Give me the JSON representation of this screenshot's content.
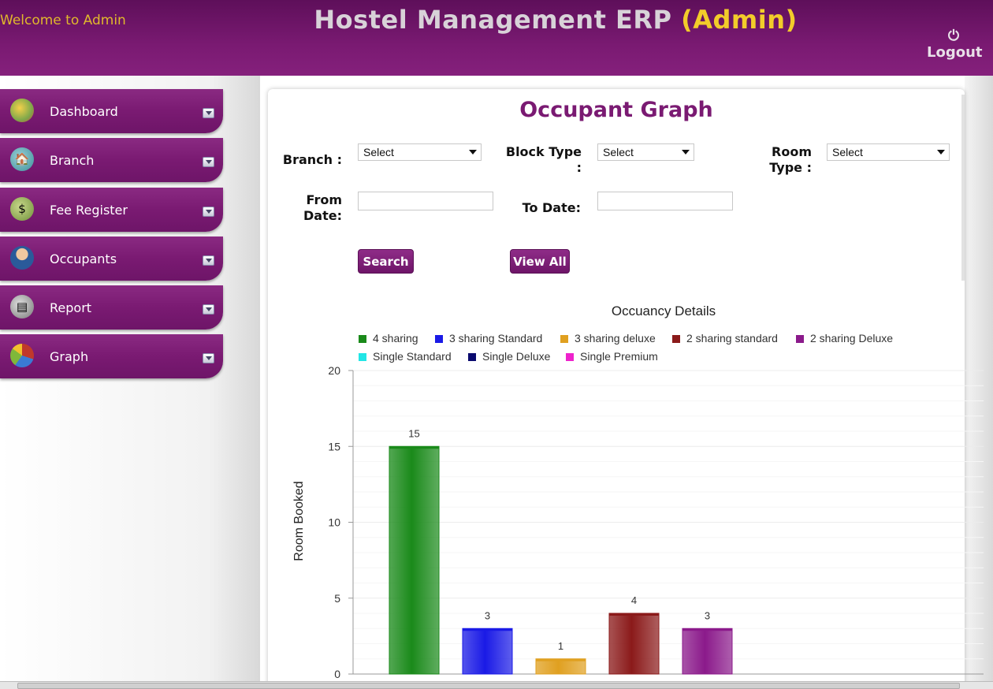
{
  "header": {
    "welcome": "Welcome to Admin",
    "title": "Hostel Management ERP",
    "role": "(Admin)",
    "logout": "Logout"
  },
  "sidebar": {
    "items": [
      {
        "label": "Dashboard",
        "icon": "dashboard-icon",
        "color": "#7fa84a"
      },
      {
        "label": "Branch",
        "icon": "home-icon",
        "color": "#3d8f9a"
      },
      {
        "label": "Fee Register",
        "icon": "money-bag-icon",
        "color": "#6f8f3a"
      },
      {
        "label": "Occupants",
        "icon": "person-icon",
        "color": "#2a5a9a"
      },
      {
        "label": "Report",
        "icon": "printer-icon",
        "color": "#777777"
      },
      {
        "label": "Graph",
        "icon": "pie-chart-icon",
        "color": "#c0392b"
      }
    ]
  },
  "page": {
    "heading": "Occupant Graph"
  },
  "form": {
    "branch_label": "Branch :",
    "branch_value": "Select",
    "block_type_label_1": "Block Type",
    "block_type_label_2": ":",
    "block_type_value": "Select",
    "room_type_label_1": "Room",
    "room_type_label_2": "Type :",
    "room_type_value": "Select",
    "from_date_label_1": "From",
    "from_date_label_2": "Date:",
    "from_date_value": "",
    "to_date_label": "To Date:",
    "to_date_value": "",
    "search_button": "Search",
    "view_all_button": "View All"
  },
  "chart_data": {
    "type": "bar",
    "title": "Occuancy Details",
    "ylabel": "Room Booked",
    "xlabel": "",
    "ylim": [
      0,
      20
    ],
    "yticks": [
      0,
      5,
      10,
      15,
      20
    ],
    "legend_position": "top",
    "series": [
      {
        "name": "4 sharing",
        "value": 15,
        "color": "#1a8a1a"
      },
      {
        "name": "3 sharing Standard",
        "value": 3,
        "color": "#1a1ae6"
      },
      {
        "name": "3 sharing deluxe",
        "value": 1,
        "color": "#e0a020"
      },
      {
        "name": "2 sharing standard",
        "value": 4,
        "color": "#8b1a1a"
      },
      {
        "name": "2 sharing Deluxe",
        "value": 3,
        "color": "#8b1a8b"
      },
      {
        "name": "Single Standard",
        "value": null,
        "color": "#22e6e6"
      },
      {
        "name": "Single Deluxe",
        "value": null,
        "color": "#0a0a6e"
      },
      {
        "name": "Single Premium",
        "value": null,
        "color": "#ee22cc"
      }
    ]
  }
}
